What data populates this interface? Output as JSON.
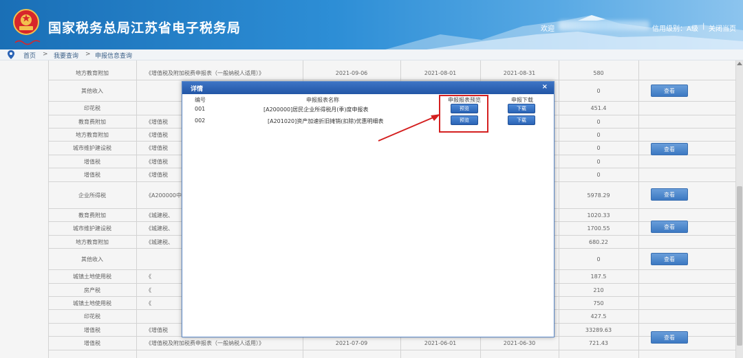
{
  "header": {
    "site_title": "国家税务总局江苏省电子税务局",
    "welcome": "欢迎",
    "credit_level": "信用级别：A级",
    "separator": "|",
    "close_page": "关闭当页",
    "colors": {
      "header_start": "#1a6fb6",
      "header_end": "#8cc4ee"
    }
  },
  "breadcrumb": {
    "home": "首页",
    "sep1": ">",
    "level1": "我要查询",
    "sep2": ">",
    "level2": "申报信息查询"
  },
  "table": {
    "rows": [
      {
        "name": "地方教育附加",
        "form": "《增值税及附加税费申报表（一般纳税人适用）》",
        "date1": "2021-09-06",
        "date2": "2021-08-01",
        "date3": "2021-08-31",
        "amount": "580"
      },
      {
        "name": "其他收入",
        "form": "",
        "date1": "",
        "date2": "",
        "date3": "",
        "amount": "0"
      },
      {
        "name": "印花税",
        "form": "",
        "date1": "",
        "date2": "",
        "date3": "",
        "amount": "451.4"
      },
      {
        "name": "教育费附加",
        "form": "《增值税",
        "date1": "",
        "date2": "",
        "date3": "",
        "amount": "0"
      },
      {
        "name": "地方教育附加",
        "form": "《增值税",
        "date1": "",
        "date2": "",
        "date3": "",
        "amount": "0"
      },
      {
        "name": "城市维护建设税",
        "form": "《增值税",
        "date1": "",
        "date2": "",
        "date3": "",
        "amount": "0"
      },
      {
        "name": "增值税",
        "form": "《增值税",
        "date1": "",
        "date2": "",
        "date3": "",
        "amount": "0"
      },
      {
        "name": "增值税",
        "form": "《增值税",
        "date1": "",
        "date2": "",
        "date3": "",
        "amount": "0"
      },
      {
        "name": "企业所得税",
        "form": "《A200000中华人",
        "date1": "",
        "date2": "",
        "date3": "",
        "amount": "5978.29"
      },
      {
        "name": "教育费附加",
        "form": "《城建税、",
        "date1": "",
        "date2": "",
        "date3": "",
        "amount": "1020.33"
      },
      {
        "name": "城市维护建设税",
        "form": "《城建税、",
        "date1": "",
        "date2": "",
        "date3": "",
        "amount": "1700.55"
      },
      {
        "name": "地方教育附加",
        "form": "《城建税、",
        "date1": "",
        "date2": "",
        "date3": "",
        "amount": "680.22"
      },
      {
        "name": "其他收入",
        "form": "",
        "date1": "",
        "date2": "",
        "date3": "",
        "amount": "0"
      },
      {
        "name": "城镇土地使用税",
        "form": "《",
        "date1": "",
        "date2": "",
        "date3": "",
        "amount": "187.5"
      },
      {
        "name": "房产税",
        "form": "《",
        "date1": "",
        "date2": "",
        "date3": "",
        "amount": "210"
      },
      {
        "name": "城镇土地使用税",
        "form": "《",
        "date1": "",
        "date2": "",
        "date3": "",
        "amount": "750"
      },
      {
        "name": "印花税",
        "form": "",
        "date1": "",
        "date2": "",
        "date3": "",
        "amount": "427.5"
      },
      {
        "name": "增值税",
        "form": "《增值税",
        "date1": "",
        "date2": "",
        "date3": "",
        "amount": "33289.63"
      },
      {
        "name": "增值税",
        "form": "《增值税及附加税费申报表（一般纳税人适用）》",
        "date1": "2021-07-09",
        "date2": "2021-06-01",
        "date3": "2021-06-30",
        "amount": "721.43"
      }
    ],
    "view_label": "查看"
  },
  "dialog": {
    "title": "详情",
    "close": "×",
    "col_no": "编号",
    "col_name": "申报报表名称",
    "col_preview": "申报报表预览",
    "col_download": "申报下载",
    "rows": [
      {
        "no": "001",
        "name": "[A200000]居民企业所得税月(季)度申报表",
        "preview": "预览",
        "download": "下载"
      },
      {
        "no": "002",
        "name": "[A201020]资产加速折旧摊销(扣除)优惠明细表",
        "preview": "预览",
        "download": "下载"
      }
    ],
    "colors": {
      "title_bar": "#2a5faf",
      "button": "#3a72c2",
      "highlight": "#d41f1f"
    }
  }
}
